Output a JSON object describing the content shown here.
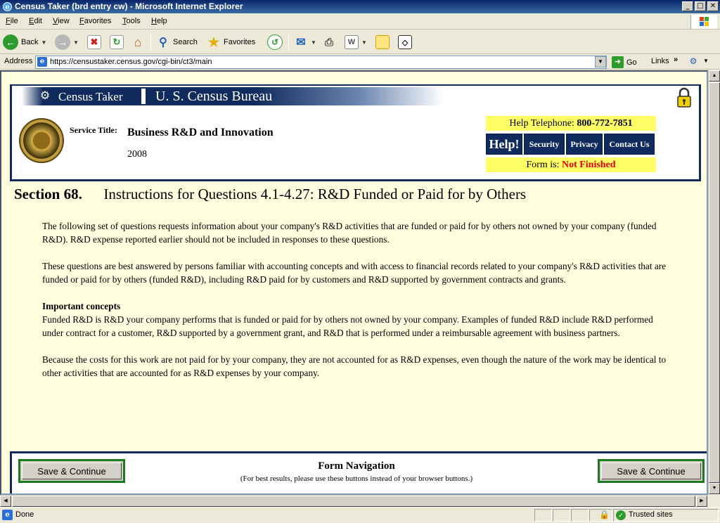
{
  "window": {
    "title": "Census Taker (brd entry cw) - Microsoft Internet Explorer",
    "controls": [
      "_",
      "□",
      "✕"
    ]
  },
  "menu": [
    "File",
    "Edit",
    "View",
    "Favorites",
    "Tools",
    "Help"
  ],
  "toolbar": {
    "back_label": "Back",
    "search_label": "Search",
    "favorites_label": "Favorites"
  },
  "address": {
    "label": "Address",
    "url": "https://censustaker.census.gov/cgi-bin/ct3/main",
    "go_label": "Go",
    "links_label": "Links"
  },
  "header": {
    "app_name": "Census Taker",
    "org_name": "U. S. Census Bureau",
    "service_label": "Service Title:",
    "service_title": "Business R&D and Innovation",
    "year": "2008",
    "help_tel_label": "Help Telephone:",
    "help_tel_number": "800-772-7851",
    "nav": {
      "help": "Help!",
      "security": "Security",
      "privacy": "Privacy",
      "contact": "Contact Us"
    },
    "form_status_label": "Form is:",
    "form_status_value": "Not Finished",
    "colors": {
      "navy": "#0f2a5c",
      "highlight": "#ffff66",
      "alert": "#e00000"
    }
  },
  "section": {
    "number": "Section 68.",
    "title": "Instructions for Questions 4.1-4.27: R&D Funded or Paid for by Others",
    "paragraphs": [
      "The following set of questions requests information about your company's R&D activities that are funded or paid for by others not owned by your company (funded R&D). R&D expense reported earlier should not be included in responses to these questions.",
      "These questions are best answered by persons familiar with accounting concepts and with access to financial records related to your company's R&D activities that are funded or paid for by others (funded R&D), including R&D paid for by customers and R&D supported by government contracts and grants."
    ],
    "concepts_heading": "Important concepts",
    "concepts_text": "Funded R&D is R&D your company performs that is funded or paid for by others not owned by your company. Examples of funded R&D include R&D performed under contract for a customer, R&D supported by a government grant, and R&D that is performed under a reimbursable agreement with business partners.",
    "final_paragraph": "Because the costs for this work are not paid for by your company, they are not accounted for as R&D expenses, even though the nature of the work may be identical to other activities that are accounted for as R&D expenses by your company."
  },
  "footer": {
    "save_left": "Save & Continue",
    "save_right": "Save & Continue",
    "nav_title": "Form Navigation",
    "nav_subtitle": "(For best results, please use these buttons instead of your browser buttons.)"
  },
  "status": {
    "text": "Done",
    "zone": "Trusted sites"
  }
}
